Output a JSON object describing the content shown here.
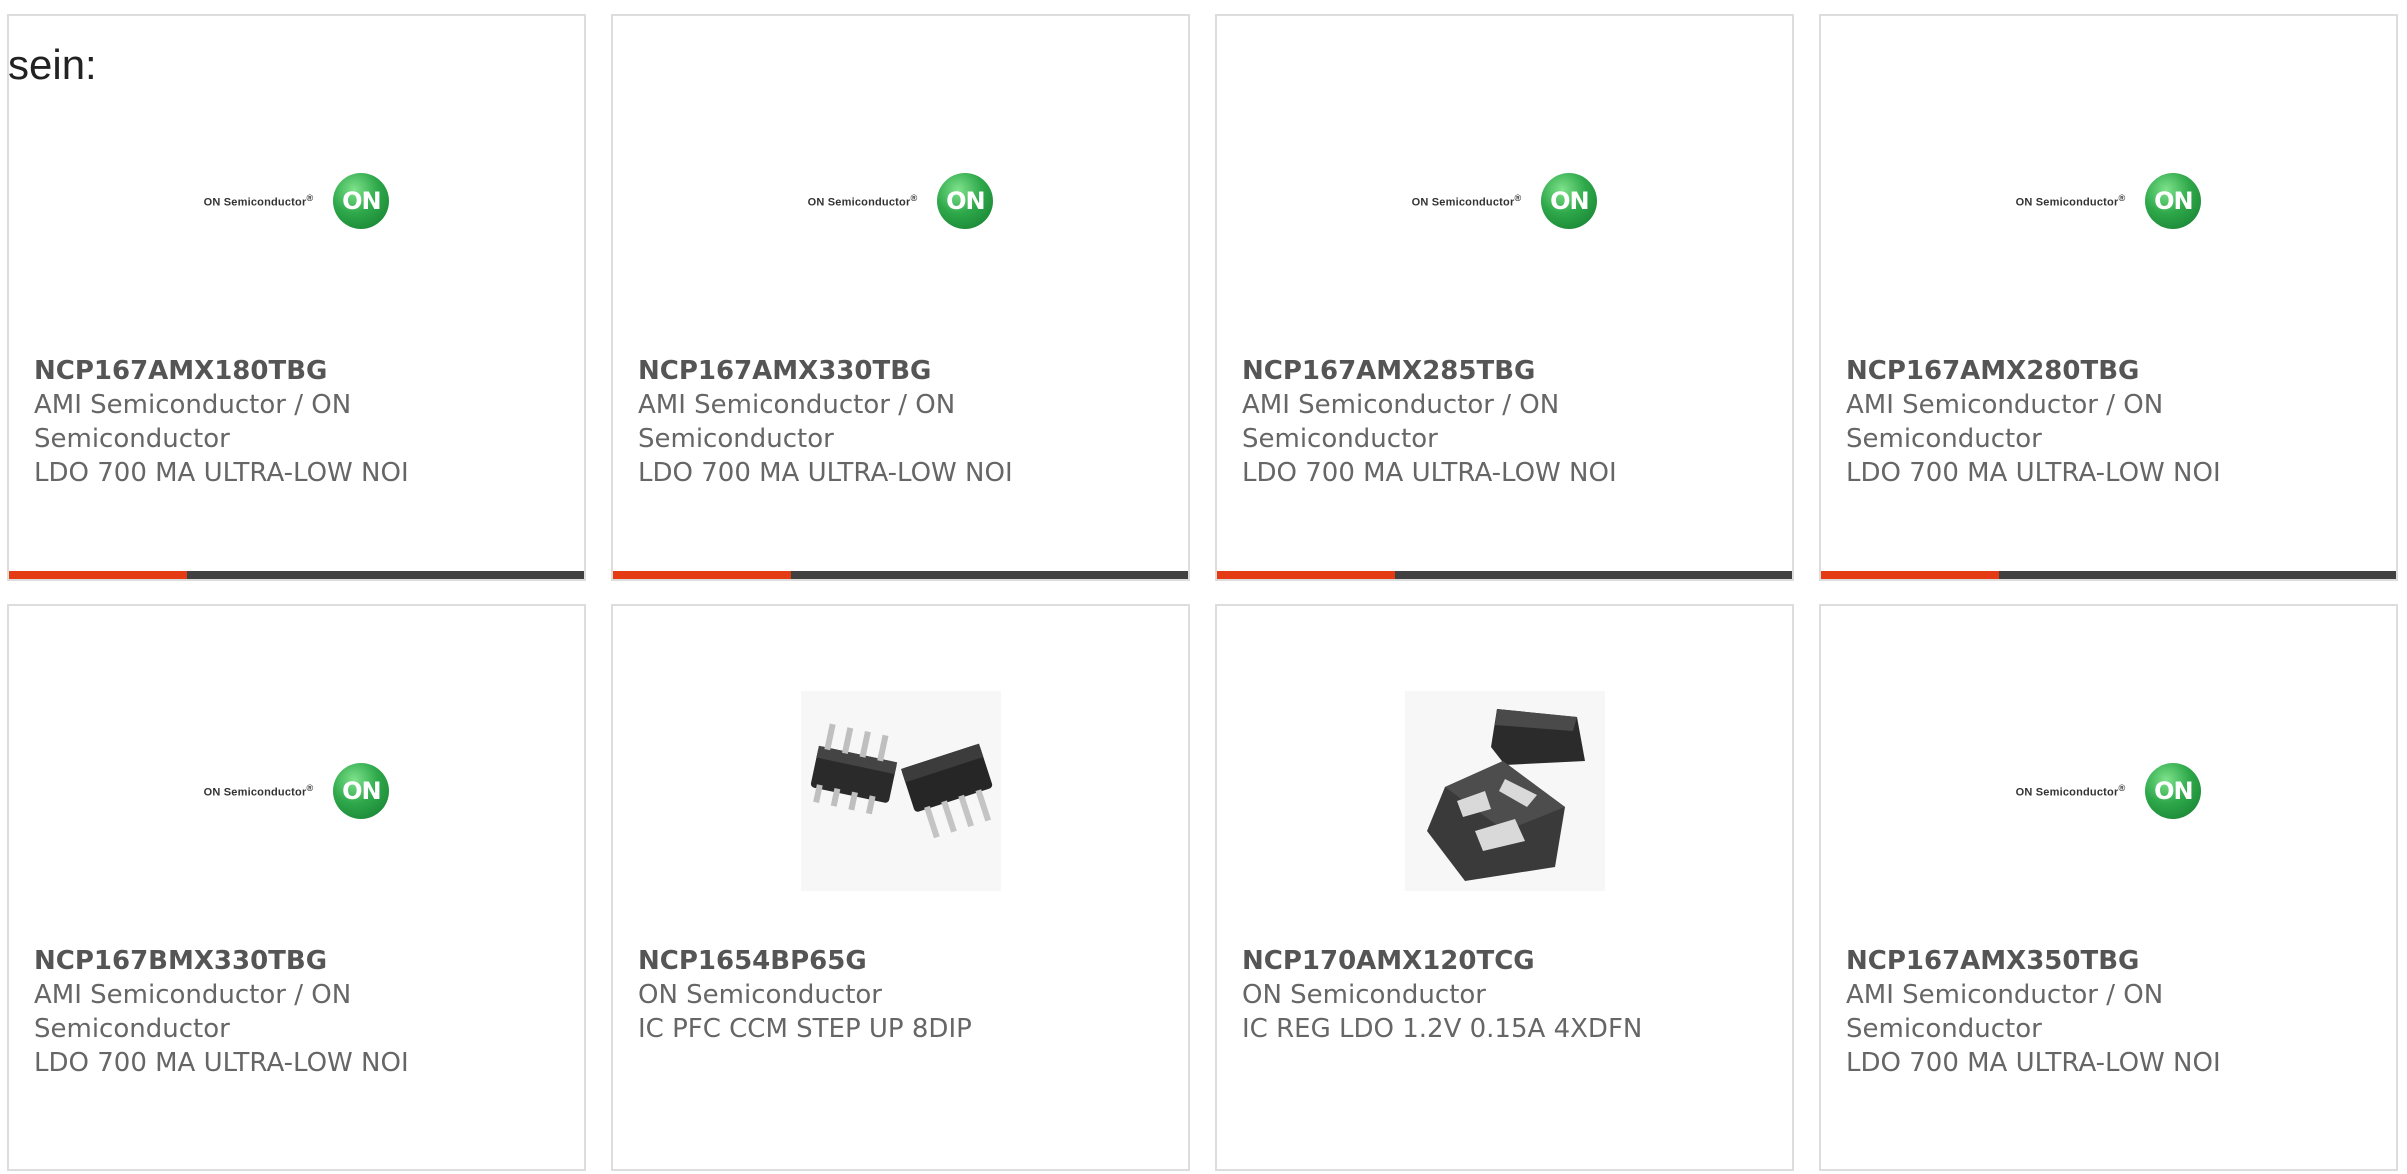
{
  "intro_text": "sein:",
  "logo": {
    "name": "ON Semiconductor",
    "trademark": "®",
    "badge": "ON",
    "brand_color": "#1f8f3c"
  },
  "accent_color": "#e43b14",
  "products": [
    {
      "part": "NCP167AMX180TBG",
      "maker_line1": "AMI Semiconductor / ON",
      "maker_line2": "Semiconductor",
      "desc": "LDO 700 MA ULTRA-LOW NOI",
      "image": "on-logo",
      "progress": 0.31
    },
    {
      "part": "NCP167AMX330TBG",
      "maker_line1": "AMI Semiconductor / ON",
      "maker_line2": "Semiconductor",
      "desc": "LDO 700 MA ULTRA-LOW NOI",
      "image": "on-logo",
      "progress": 0.31
    },
    {
      "part": "NCP167AMX285TBG",
      "maker_line1": "AMI Semiconductor / ON",
      "maker_line2": "Semiconductor",
      "desc": "LDO 700 MA ULTRA-LOW NOI",
      "image": "on-logo",
      "progress": 0.31
    },
    {
      "part": "NCP167AMX280TBG",
      "maker_line1": "AMI Semiconductor / ON",
      "maker_line2": "Semiconductor",
      "desc": "LDO 700 MA ULTRA-LOW NOI",
      "image": "on-logo",
      "progress": 0.31
    },
    {
      "part": "NCP167BMX330TBG",
      "maker_line1": "AMI Semiconductor / ON",
      "maker_line2": "Semiconductor",
      "desc": "LDO 700 MA ULTRA-LOW NOI",
      "image": "on-logo"
    },
    {
      "part": "NCP1654BP65G",
      "maker_line1": "ON Semiconductor",
      "maker_line2": "",
      "desc": "IC PFC CCM STEP UP 8DIP",
      "image": "dip8-chip"
    },
    {
      "part": "NCP170AMX120TCG",
      "maker_line1": "ON Semiconductor",
      "maker_line2": "",
      "desc": "IC REG LDO 1.2V 0.15A 4XDFN",
      "image": "xdfn-chip"
    },
    {
      "part": "NCP167AMX350TBG",
      "maker_line1": "AMI Semiconductor / ON",
      "maker_line2": "Semiconductor",
      "desc": "LDO 700 MA ULTRA-LOW NOI",
      "image": "on-logo"
    }
  ]
}
